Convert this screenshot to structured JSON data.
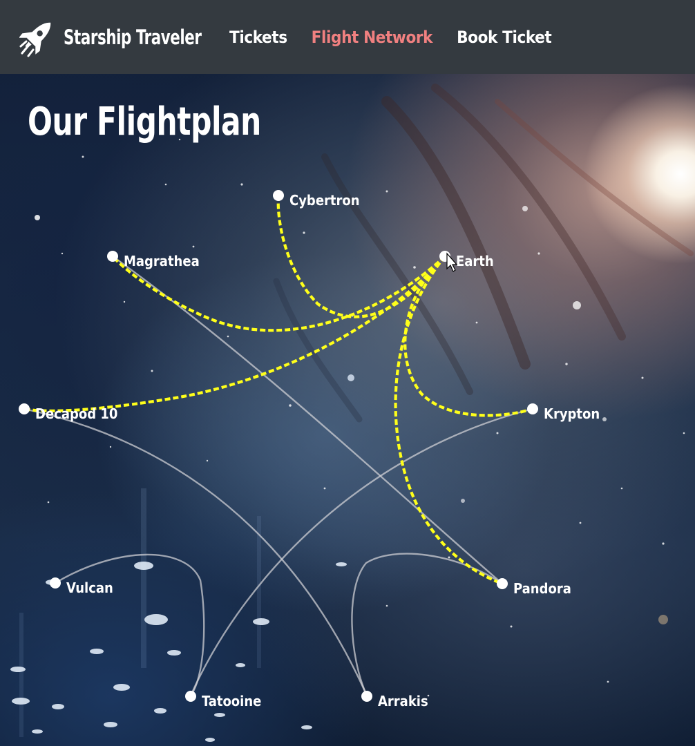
{
  "brand": {
    "name": "Starship Traveler",
    "icon": "rocket-icon"
  },
  "nav": {
    "items": [
      {
        "label": "Tickets",
        "active": false
      },
      {
        "label": "Flight Network",
        "active": true
      },
      {
        "label": "Book Ticket",
        "active": false
      }
    ]
  },
  "main": {
    "title": "Our Flightplan"
  },
  "planets": [
    {
      "id": "cybertron",
      "name": "Cybertron"
    },
    {
      "id": "magrathea",
      "name": "Magrathea"
    },
    {
      "id": "earth",
      "name": "Earth"
    },
    {
      "id": "decapod-10",
      "name": "Decapod 10"
    },
    {
      "id": "krypton",
      "name": "Krypton"
    },
    {
      "id": "vulcan",
      "name": "Vulcan"
    },
    {
      "id": "pandora",
      "name": "Pandora"
    },
    {
      "id": "tatooine",
      "name": "Tatooine"
    },
    {
      "id": "arrakis",
      "name": "Arrakis"
    }
  ],
  "routes": [
    {
      "from": "Magrathea",
      "to": "Pandora",
      "highlighted": false
    },
    {
      "from": "Decapod 10",
      "to": "Arrakis",
      "highlighted": false
    },
    {
      "from": "Krypton",
      "to": "Tatooine",
      "highlighted": false
    },
    {
      "from": "Vulcan",
      "to": "Tatooine",
      "highlighted": false
    },
    {
      "from": "Pandora",
      "to": "Arrakis",
      "highlighted": false
    },
    {
      "from": "Earth",
      "to": "Cybertron",
      "highlighted": true
    },
    {
      "from": "Earth",
      "to": "Magrathea",
      "highlighted": true
    },
    {
      "from": "Earth",
      "to": "Decapod 10",
      "highlighted": true
    },
    {
      "from": "Earth",
      "to": "Krypton",
      "highlighted": true
    },
    {
      "from": "Earth",
      "to": "Pandora",
      "highlighted": true
    }
  ],
  "colors": {
    "navbar": "#343a40",
    "nav_active": "#f08080",
    "route_highlight": "#ffff1a",
    "route_default": "#d2d2d7"
  }
}
